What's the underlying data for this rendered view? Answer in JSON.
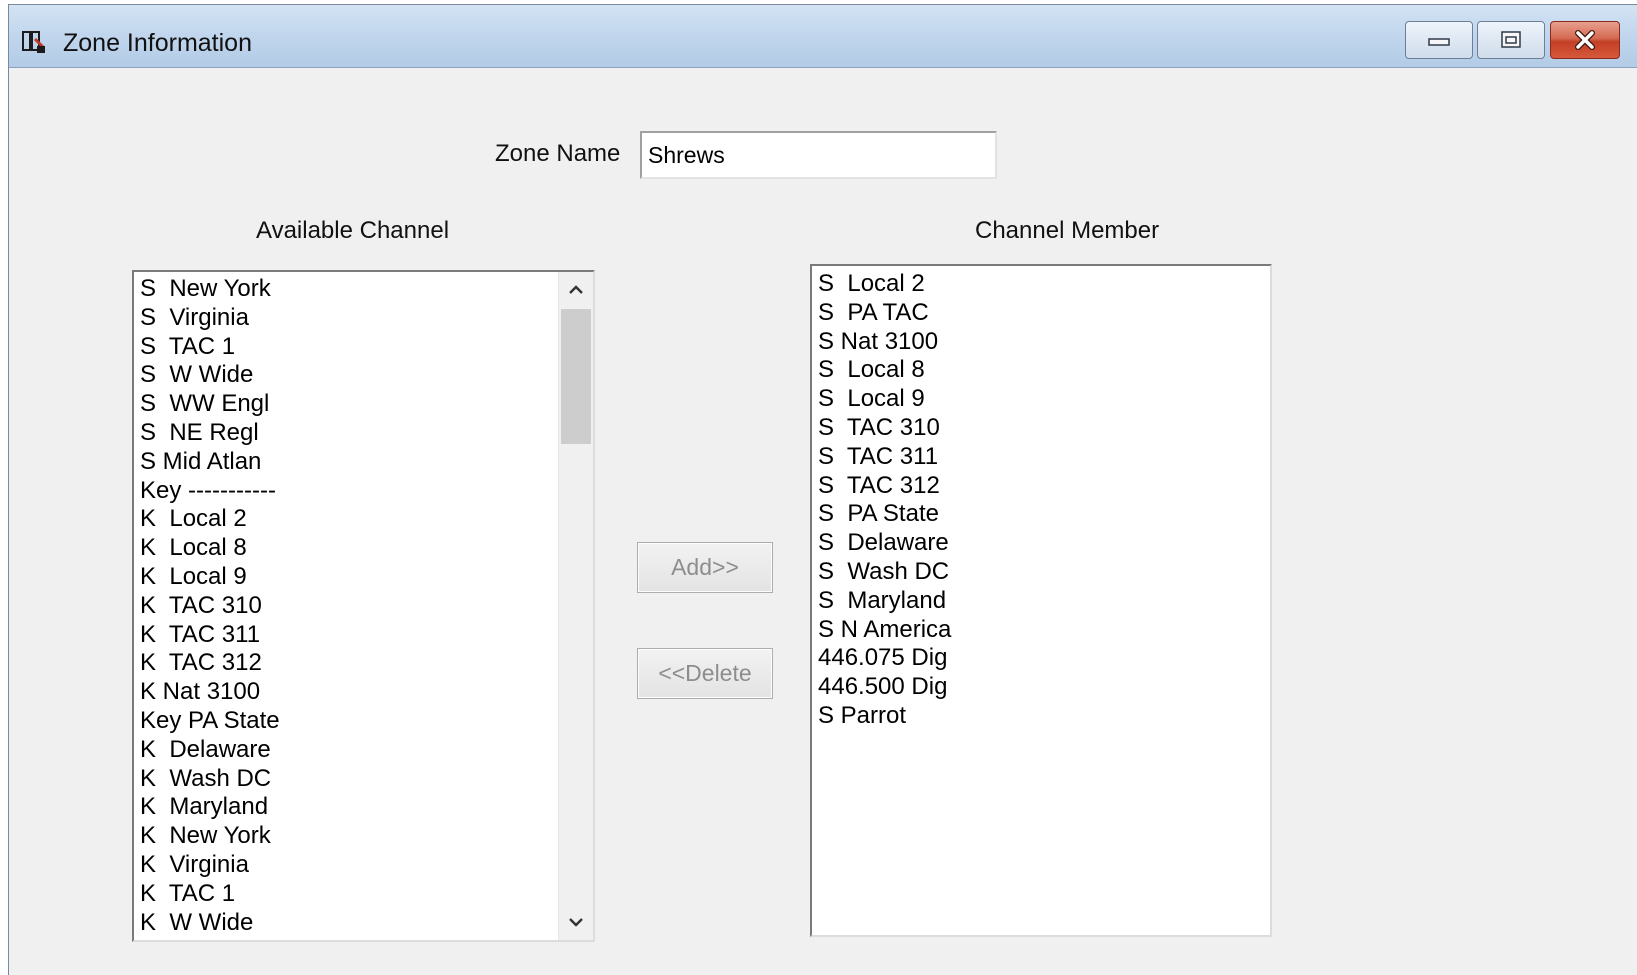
{
  "window": {
    "title": "Zone Information",
    "icon": "zone-app-icon",
    "controls": {
      "minimize": "minimize-icon",
      "maximize": "maximize-icon",
      "close": "close-icon"
    }
  },
  "form": {
    "zone_name_label": "Zone Name",
    "zone_name_value": "Shrews"
  },
  "available": {
    "label": "Available Channel",
    "items": [
      "S  New York",
      "S  Virginia",
      "S  TAC 1",
      "S  W Wide",
      "S  WW Engl",
      "S  NE Regl",
      "S Mid Atlan",
      "Key -----------",
      "K  Local 2",
      "K  Local 8",
      "K  Local 9",
      "K  TAC 310",
      "K  TAC 311",
      "K  TAC 312",
      "K Nat 3100",
      "Key PA State",
      "K  Delaware",
      "K  Wash DC",
      "K  Maryland",
      "K  New York",
      "K  Virginia",
      "K  TAC 1",
      "K  W Wide"
    ],
    "scroll_fraction": 0.0
  },
  "buttons": {
    "add": "Add>>",
    "delete": "<<Delete"
  },
  "members": {
    "label": "Channel Member",
    "items": [
      "S  Local 2",
      "S  PA TAC",
      "S Nat 3100",
      "S  Local 8",
      "S  Local 9",
      "S  TAC 310",
      "S  TAC 311",
      "S  TAC 312",
      "S  PA State",
      "S  Delaware",
      "S  Wash DC",
      "S  Maryland",
      "S N America",
      "446.075 Dig",
      "446.500 Dig",
      "S Parrot"
    ]
  },
  "colors": {
    "titlebar": "#c2d7ee",
    "close_button": "#c94a30",
    "dialog_background": "#f0f0f0",
    "disabled_text": "#8d8d8d"
  }
}
